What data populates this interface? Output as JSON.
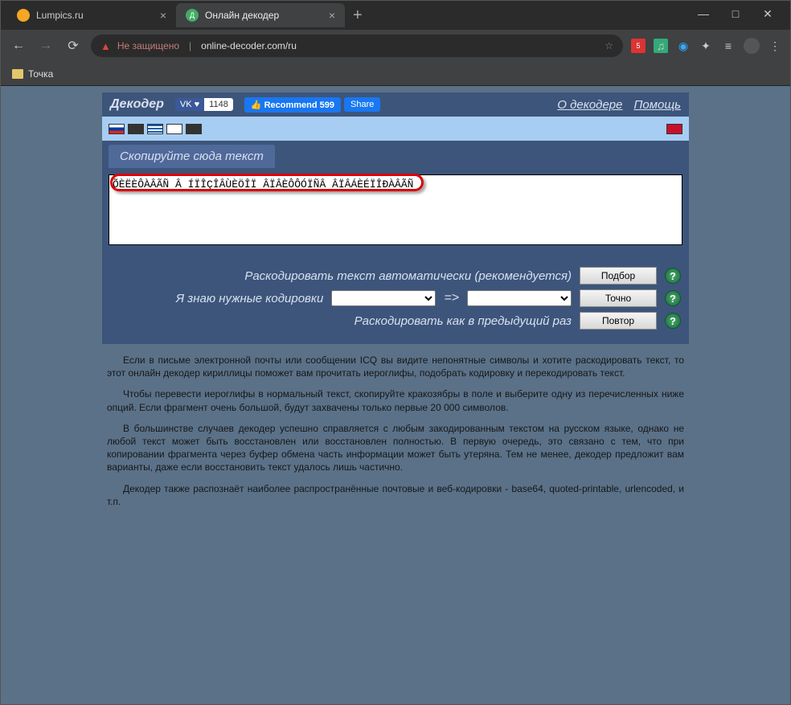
{
  "window": {
    "tabs": [
      {
        "title": "Lumpics.ru",
        "active": false
      },
      {
        "title": "Онлайн декодер",
        "active": true
      }
    ]
  },
  "browser": {
    "warning_label": "Не защищено",
    "url": "online-decoder.com/ru",
    "bookmark_label": "Точка"
  },
  "topbar": {
    "brand": "Декодер",
    "vk_label": "VK ♥",
    "vk_count": "1148",
    "fb_recommend": "Recommend 599",
    "fb_share": "Share",
    "link_about": "О декодере",
    "link_help": "Помощь"
  },
  "section": {
    "tab_label": "Скопируйте сюда текст",
    "textarea_value": "ÕÈËÈÔÀÂÃÑ Â ÍÏÎÇÎÂÙÈÖÎÏ ÂÏÂÈÔÔÓÏÑÂ ÂÏÂÁÈÉÏÎÐÀÂÃÑ"
  },
  "controls": {
    "row1_label": "Раскодировать текст автоматически (рекомендуется)",
    "row1_btn": "Подбор",
    "row2_label": "Я знаю нужные кодировки",
    "row2_arrow": "=>",
    "row2_btn": "Точно",
    "row3_label": "Раскодировать как в предыдущий раз",
    "row3_btn": "Повтор"
  },
  "desc": {
    "p1": "Если в письме электронной почты или сообщении ICQ вы видите непонятные символы и хотите раскодировать текст, то этот онлайн декодер кириллицы поможет вам прочитать иероглифы, подобрать кодировку и перекодировать текст.",
    "p2": "Чтобы перевести иероглифы в нормальный текст, скопируйте кракозябры в поле и выберите одну из перечисленных ниже опций. Если фрагмент очень большой, будут захвачены только первые 20 000 символов.",
    "p3": "В большинстве случаев декодер успешно справляется с любым закодированным текстом на русском языке, однако не любой текст может быть восстановлен или восстановлен полностью. В первую очередь, это связано с тем, что при копировании фрагмента через буфер обмена часть информации может быть утеряна. Тем не менее, декодер предложит вам варианты, даже если восстановить текст удалось лишь частично.",
    "p4": "Декодер также распознаёт наиболее распространённые почтовые и веб-кодировки - base64, quoted-printable, urlencoded, и т.п."
  }
}
